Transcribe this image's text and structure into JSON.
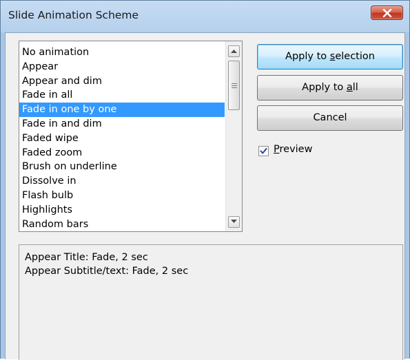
{
  "window": {
    "title": "Slide Animation Scheme",
    "close_icon": "close-icon"
  },
  "animation_list": {
    "items": [
      "No animation",
      "Appear",
      "Appear and dim",
      "Fade in all",
      "Fade in one by one",
      "Fade in and dim",
      "Faded wipe",
      "Faded zoom",
      "Brush on underline",
      "Dissolve in",
      "Flash bulb",
      "Highlights",
      "Random bars"
    ],
    "selected": "Fade in one by one",
    "selection_color": "#3399ff"
  },
  "buttons": {
    "apply_selection": {
      "before": "Apply to ",
      "accel": "s",
      "after": "election"
    },
    "apply_all": {
      "before": "Apply to ",
      "accel": "a",
      "after": "ll"
    },
    "cancel": "Cancel"
  },
  "preview": {
    "checked": true,
    "accel": "P",
    "rest": "review"
  },
  "description": {
    "lines": [
      "Appear Title: Fade, 2 sec",
      "Appear Subtitle/text: Fade, 2 sec"
    ]
  }
}
